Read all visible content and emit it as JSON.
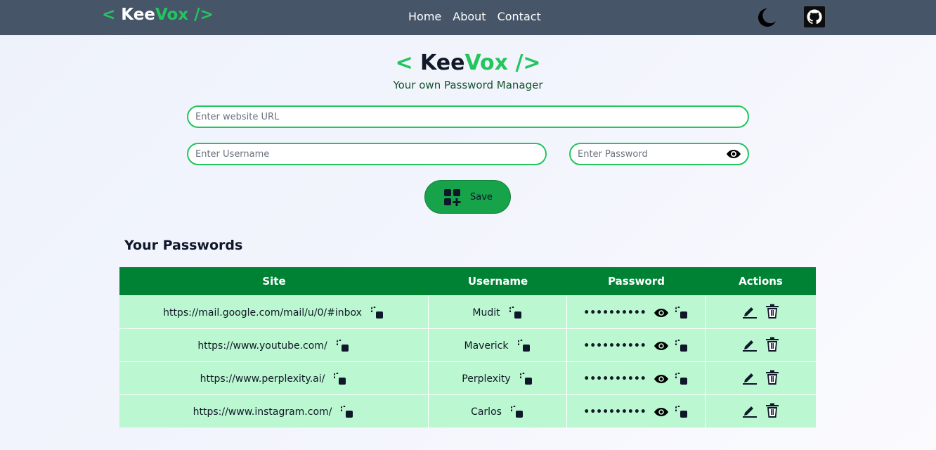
{
  "navbar": {
    "brand_lt": "< ",
    "brand_kee": "Kee",
    "brand_vox": "Vox",
    "brand_gt": " />",
    "links": [
      "Home",
      "About",
      "Contact"
    ],
    "icons": [
      "moon-icon",
      "github-icon"
    ]
  },
  "hero": {
    "brand_lt": "< ",
    "brand_kee": "Kee",
    "brand_vox": "Vox",
    "brand_gt": " />",
    "tagline": "Your own Password Manager"
  },
  "form": {
    "url_placeholder": "Enter website URL",
    "username_placeholder": "Enter Username",
    "password_placeholder": "Enter Password",
    "save_label": "Save"
  },
  "passwords": {
    "title": "Your Passwords",
    "headers": [
      "Site",
      "Username",
      "Password",
      "Actions"
    ],
    "rows": [
      {
        "site": "https://mail.google.com/mail/u/0/#inbox",
        "username": "Mudit",
        "password": "••••••••••"
      },
      {
        "site": "https://www.youtube.com/",
        "username": "Maverick",
        "password": "••••••••••"
      },
      {
        "site": "https://www.perplexity.ai/",
        "username": "Perplexity",
        "password": "••••••••••"
      },
      {
        "site": "https://www.instagram.com/",
        "username": "Carlos",
        "password": "••••••••••"
      }
    ]
  },
  "colors": {
    "navbar_bg": "#475569",
    "accent_green": "#22c55e",
    "table_header": "#008234",
    "row_bg": "#bbf7d0",
    "save_button": "#16a34a"
  }
}
